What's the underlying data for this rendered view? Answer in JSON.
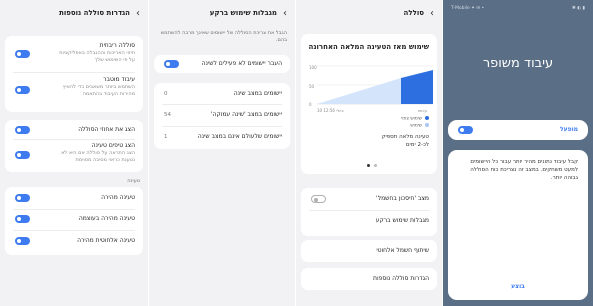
{
  "panel1": {
    "title": "הגדרות סוללה נוספות",
    "items": [
      {
        "label": "סוללה ריבוזית",
        "sub": "חיזוי האריכות וההגבלה באפליקציות על פי השימוש שלך"
      },
      {
        "label": "עיבוד מוטבר",
        "sub": "השתמש ביותר משאבים כדי להאיץ מהירות העיבוד בהתאמה"
      },
      {
        "label": "הצג את אחוזי הסוללה",
        "sub": ""
      },
      {
        "label": "הצג טיפים טעינה",
        "sub": "הצג התראה על סוללה אם היא לא נטענת כראוי מסיבה מסוימת"
      }
    ],
    "charging_header": "טעינה",
    "charging_items": [
      {
        "label": "טעינה מהירה"
      },
      {
        "label": "טעינה מהירה בעוצמה"
      },
      {
        "label": "טעינה אלחוטית מהירה"
      }
    ]
  },
  "panel2": {
    "title": "מגבלות שימוש ברקע",
    "description": "הגבל את צריכת הסוללה של יישומים שאינך מרבה להשתמש בהם.",
    "sleep_toggle_label": "העבר יישומים לא פעילים לשינה",
    "items": [
      {
        "label": "יישומים במצב שינה",
        "value": "0"
      },
      {
        "label": "יישומים במצב 'שינה עמוקה'",
        "value": "54"
      },
      {
        "label": "יישומים שלעולם אינם במצב שינה",
        "value": "1"
      }
    ]
  },
  "panel3": {
    "title": "סוללה",
    "chart_title": "שימוש מאז הטעינה המלאה האחרונה",
    "y_ticks": [
      "100",
      "50",
      "0"
    ],
    "x_ticks": [
      "10 ביולי 12:56",
      "עכשיו"
    ],
    "legend": [
      {
        "label": "שימוש צפוי",
        "color": "#2d6fe0"
      },
      {
        "label": "שימוש",
        "color": "#a9c8f5"
      }
    ],
    "estimate": "טעינה מלאה תספיק לכ-2 ימים",
    "items": [
      {
        "label": "מצב 'חיסכון בחשמל'"
      },
      {
        "label": "מגבלות שימוש ברקע"
      },
      {
        "label": "שיתוף חשמל אלחוטי"
      },
      {
        "label": "הגדרות סוללה נוספות"
      }
    ]
  },
  "panel4": {
    "status": "T-Mobile ✦ ✉ •",
    "status_right": "✱ ◐ ▮",
    "title": "עיבוד משופר",
    "toggle_label": "מופעל",
    "description": "קבל עיבוד נתונים מהיר יותר עבור כל היישומים למעט משחקים. במצב זה נצריכת כוח הסוללה גבוהה יותר.",
    "done_label": "בוצע"
  },
  "colors": {
    "accent": "#3e7bf0",
    "panel_bg": "#f2f2f4",
    "lock_bg": "#5a6e86"
  }
}
